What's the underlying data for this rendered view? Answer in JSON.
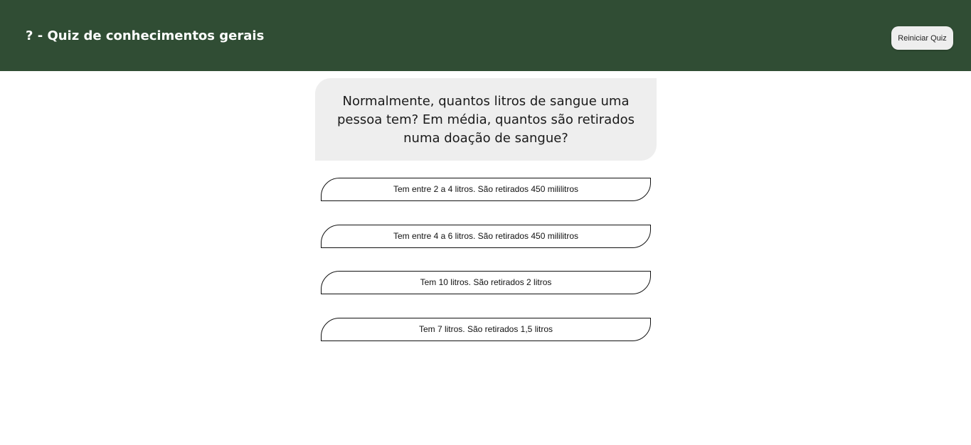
{
  "header": {
    "title": "? - Quiz de conhecimentos gerais",
    "restart_label": "Reiniciar Quiz",
    "background_color": "#304d34"
  },
  "question": {
    "text": "Normalmente, quantos litros de sangue uma pessoa tem? Em média, quantos são retirados numa doação de sangue?"
  },
  "answers": [
    {
      "label": "Tem entre 2 a 4 litros. São retirados 450 mililitros"
    },
    {
      "label": "Tem entre 4 a 6 litros. São retirados 450 mililitros"
    },
    {
      "label": "Tem 10 litros. São retirados 2 litros"
    },
    {
      "label": "Tem 7 litros. São retirados 1,5 litros"
    }
  ]
}
